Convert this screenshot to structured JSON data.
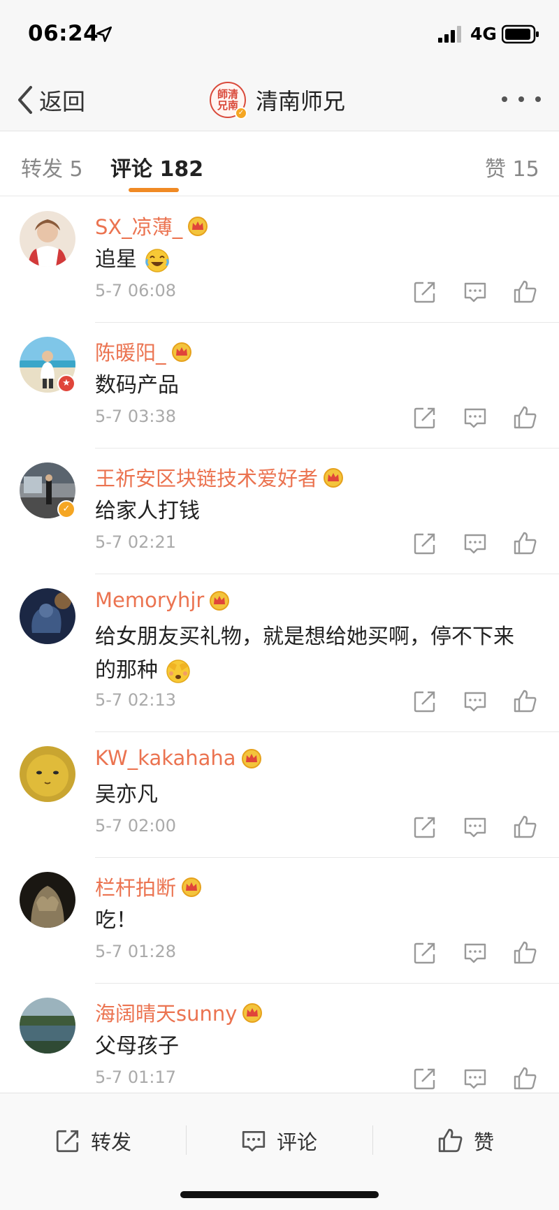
{
  "status_bar": {
    "time": "06:24",
    "network": "4G"
  },
  "nav": {
    "back_label": "返回",
    "title": "清南师兄",
    "avatar_text": "師清兄南"
  },
  "tabs": {
    "repost": "转发 5",
    "comment": "评论 182",
    "like": "赞 15"
  },
  "comments": [
    {
      "user": "SX_凉薄_",
      "text": "追星",
      "emoji": "laugh-cry-emoji",
      "time": "5-7 06:08",
      "avatar_color": "#d8b89a",
      "badge": ""
    },
    {
      "user": "陈暖阳_",
      "text": "数码产品",
      "emoji": "",
      "time": "5-7 03:38",
      "avatar_color": "#6fb7d8",
      "badge": "red"
    },
    {
      "user": "王祈安区块链技术爱好者",
      "text": "给家人打钱",
      "emoji": "",
      "time": "5-7 02:21",
      "avatar_color": "#6a6a6a",
      "badge": "gold"
    },
    {
      "user": "Memoryhjr",
      "text": "给女朋友买礼物，就是想给她买啊，停不下来的那种",
      "emoji": "shy-emoji",
      "time": "5-7 02:13",
      "avatar_color": "#2b3b5e",
      "badge": ""
    },
    {
      "user": "KW_kakahaha",
      "text": "吴亦凡",
      "emoji": "",
      "time": "5-7 02:00",
      "avatar_color": "#c9a531",
      "badge": ""
    },
    {
      "user": "栏杆拍断",
      "text": "吃！",
      "emoji": "",
      "time": "5-7 01:28",
      "avatar_color": "#3a3226",
      "badge": ""
    },
    {
      "user": "海阔晴天sunny",
      "text": "父母孩子",
      "emoji": "",
      "time": "5-7 01:17",
      "avatar_color": "#4e6a6f",
      "badge": ""
    }
  ],
  "bottom_bar": {
    "repost": "转发",
    "comment": "评论",
    "like": "赞"
  },
  "colors": {
    "accent": "#f08a24",
    "username": "#eb7350",
    "muted": "#aaaaaa"
  }
}
